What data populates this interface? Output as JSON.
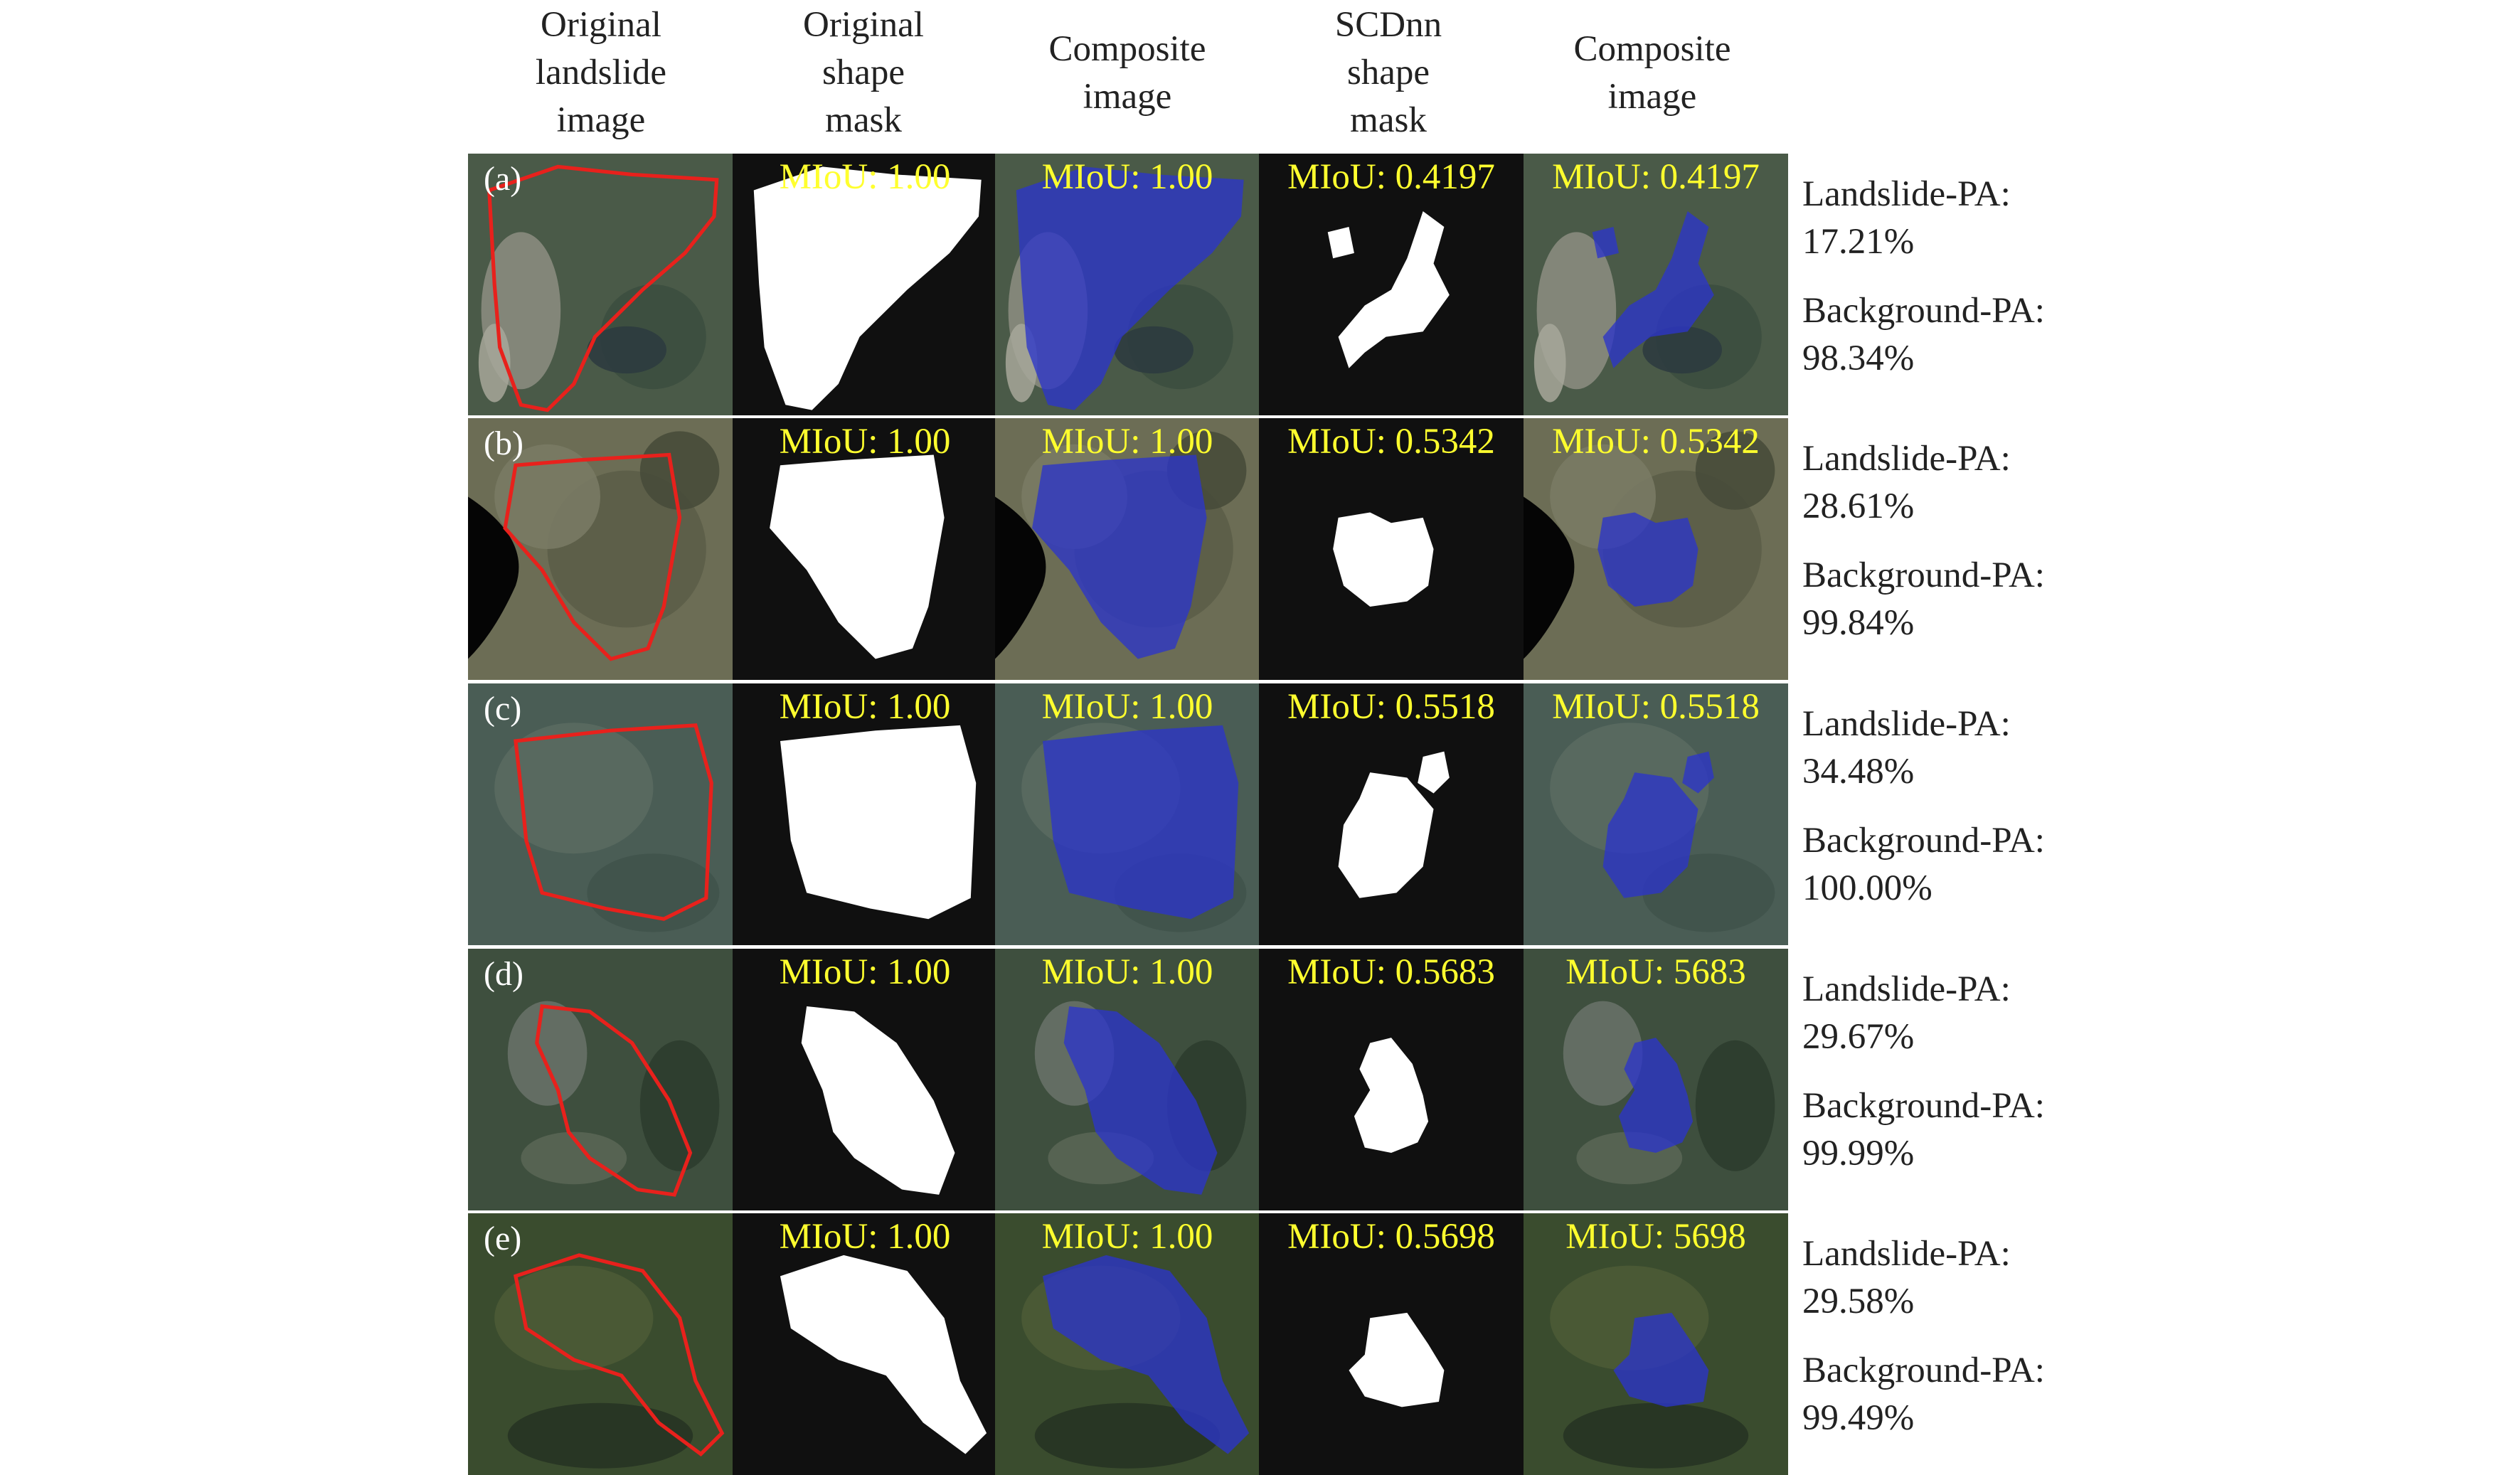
{
  "headers": [
    [
      "Original",
      "landslide",
      "image"
    ],
    [
      "Original",
      "shape",
      "mask"
    ],
    [
      "Composite",
      "image"
    ],
    [
      "SCDnn",
      "shape",
      "mask"
    ],
    [
      "Composite",
      "image"
    ]
  ],
  "rows": [
    {
      "label": "(a)",
      "miou_orig_mask": "MIoU: 1.00",
      "miou_orig_comp": "MIoU: 1.00",
      "miou_scd_mask": "MIoU: 0.4197",
      "miou_scd_comp": "MIoU: 0.4197",
      "landslide_label": "Landslide-PA:",
      "landslide_value": "17.21%",
      "background_label": "Background-PA:",
      "background_value": "98.34%"
    },
    {
      "label": "(b)",
      "miou_orig_mask": "MIoU: 1.00",
      "miou_orig_comp": "MIoU: 1.00",
      "miou_scd_mask": "MIoU: 0.5342",
      "miou_scd_comp": "MIoU: 0.5342",
      "landslide_label": "Landslide-PA:",
      "landslide_value": "28.61%",
      "background_label": "Background-PA:",
      "background_value": "99.84%"
    },
    {
      "label": "(c)",
      "miou_orig_mask": "MIoU: 1.00",
      "miou_orig_comp": "MIoU: 1.00",
      "miou_scd_mask": "MIoU: 0.5518",
      "miou_scd_comp": "MIoU: 0.5518",
      "landslide_label": "Landslide-PA:",
      "landslide_value": "34.48%",
      "background_label": "Background-PA:",
      "background_value": "100.00%"
    },
    {
      "label": "(d)",
      "miou_orig_mask": "MIoU: 1.00",
      "miou_orig_comp": "MIoU: 1.00",
      "miou_scd_mask": "MIoU: 0.5683",
      "miou_scd_comp": "MIoU: 5683",
      "landslide_label": "Landslide-PA:",
      "landslide_value": "29.67%",
      "background_label": "Background-PA:",
      "background_value": "99.99%"
    },
    {
      "label": "(e)",
      "miou_orig_mask": "MIoU: 1.00",
      "miou_orig_comp": "MIoU: 1.00",
      "miou_scd_mask": "MIoU: 0.5698",
      "miou_scd_comp": "MIoU: 5698",
      "landslide_label": "Landslide-PA:",
      "landslide_value": "29.58%",
      "background_label": "Background-PA:",
      "background_value": "99.49%"
    }
  ],
  "colors": {
    "outline": "#e8211c",
    "overlay": "#2b35c9",
    "miou_text": "#ffff2e",
    "mask_bg": "#101010",
    "mask_fg": "#ffffff"
  }
}
